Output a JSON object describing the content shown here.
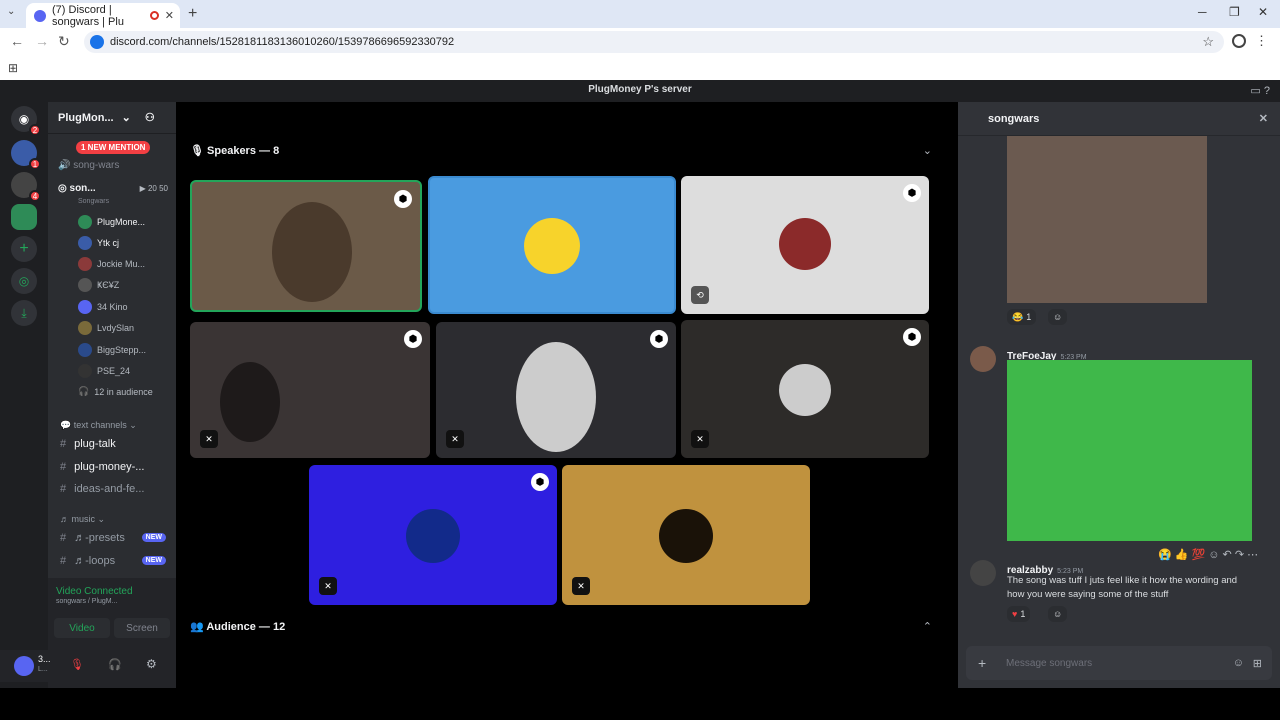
{
  "browser": {
    "tab_title": "(7) Discord | songwars | Plu",
    "tab_close": "✕",
    "new_tab": "+",
    "url": "discord.com/channels/1528181183136010260/1539786696592330792"
  },
  "discord": {
    "server_title": "PlugMoney P's server",
    "server_name": "PlugMon...",
    "mention_badge": "1 NEW MENTION",
    "guild_badges": [
      "2",
      "1",
      "4"
    ],
    "channels": {
      "stage_channel": "song-wars",
      "voice_channel": "son...",
      "voice_sub": "Songwars",
      "voice_count_a": "20",
      "voice_count_b": "50",
      "voice_users": [
        "PlugMone...",
        "Ytk cj",
        "Jockie Mu...",
        "ҜЄ¥Ζ",
        "34 Kino",
        "LvdySlan",
        "BiggStepp...",
        "PSE_24"
      ],
      "audience_count": "12 in audience",
      "text_category": "text channels",
      "text_channels": [
        "plug-talk",
        "plug-money-...",
        "ideas-and-fe..."
      ],
      "music_category": "music",
      "music_channels": [
        "♬-presets",
        "♬-loops"
      ],
      "new_label": "NEW"
    },
    "voice_panel": {
      "status": "Video Connected",
      "sub": "songwars / PlugM...",
      "video_btn": "Video",
      "screen_btn": "Screen"
    },
    "user": {
      "name": "3...",
      "sub": "L..."
    },
    "stage": {
      "speakers_header": "Speakers — 8",
      "audience_header": "Audience — 12"
    },
    "panel": {
      "channel": "songwars",
      "messages": [
        {
          "author": "TreFoeJay",
          "time": "5:23 PM"
        },
        {
          "author": "realzabby",
          "time": "5:23 PM",
          "text": "The song was tuff I juts feel like it how the wording and how you were saying some of the stuff"
        }
      ],
      "reaction_count": "1",
      "composer_placeholder": "Message songwars"
    }
  },
  "colors": {
    "blurple": "#5865f2",
    "red": "#f23f43",
    "green": "#23a55a"
  }
}
